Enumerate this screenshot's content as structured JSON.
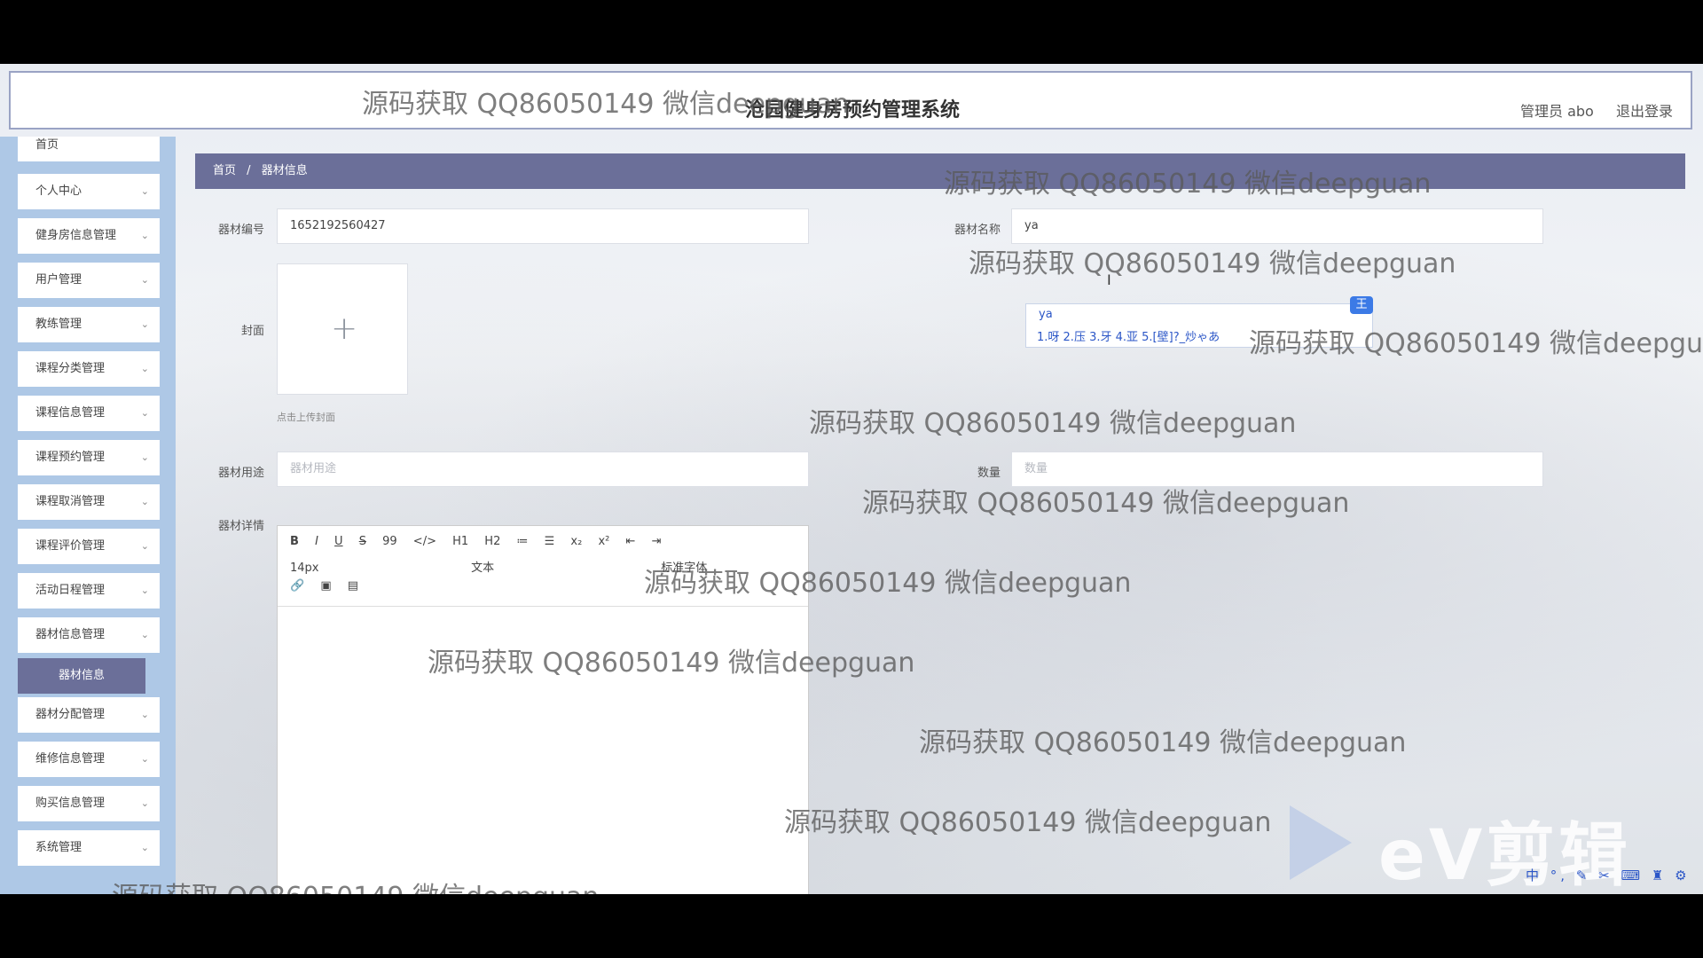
{
  "header": {
    "title": "沧园健身房预约管理系统",
    "admin": "管理员 abo",
    "logout": "退出登录"
  },
  "sidebar": {
    "items": [
      {
        "label": "首页"
      },
      {
        "label": "个人中心"
      },
      {
        "label": "健身房信息管理"
      },
      {
        "label": "用户管理"
      },
      {
        "label": "教练管理"
      },
      {
        "label": "课程分类管理"
      },
      {
        "label": "课程信息管理"
      },
      {
        "label": "课程预约管理"
      },
      {
        "label": "课程取消管理"
      },
      {
        "label": "课程评价管理"
      },
      {
        "label": "活动日程管理"
      },
      {
        "label": "器材信息管理"
      },
      {
        "label": "器材分配管理"
      },
      {
        "label": "维修信息管理"
      },
      {
        "label": "购买信息管理"
      },
      {
        "label": "系统管理"
      }
    ],
    "active_sub": "器材信息",
    "chevron": "⌄"
  },
  "breadcrumb": {
    "home": "首页",
    "sep": "/",
    "current": "器材信息"
  },
  "form": {
    "equip_no_label": "器材编号",
    "equip_no_value": "1652192560427",
    "equip_name_label": "器材名称",
    "equip_name_value": "ya",
    "cover_label": "封面",
    "cover_plus": "+",
    "cover_tip": "点击上传封面",
    "usage_label": "器材用途",
    "usage_placeholder": "器材用途",
    "qty_label": "数量",
    "qty_placeholder": "数量",
    "detail_label": "器材详情"
  },
  "editor": {
    "row1": [
      "B",
      "I",
      "U",
      "S",
      "99",
      "</>",
      "H1",
      "H2",
      "≔",
      "☰",
      "x₂",
      "x²",
      "⇤",
      "⇥"
    ],
    "font_size": "14px",
    "text_type": "文本",
    "font_family": "标准字体",
    "row3_icons": [
      "link-icon",
      "image-icon",
      "video-icon"
    ]
  },
  "ime": {
    "pinyin": "ya",
    "candidates": "1.呀  2.压  3.牙  4.亚  5.[壁]?_炒ゃあ",
    "badge": "王"
  },
  "watermark": "源码获取 QQ86050149 微信deepguan",
  "ev_brand": "eV剪辑",
  "tray": "中 °, ✎ ✂ ⌨ ♜ ⚙"
}
